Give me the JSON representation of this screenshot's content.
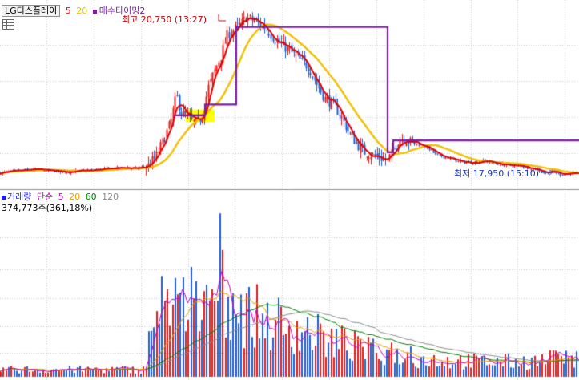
{
  "price_panel": {
    "stock_chip": "LG디스플레이",
    "ma_labels": [
      {
        "text": "5",
        "color": "#ff0000"
      },
      {
        "text": "20",
        "color": "#f2c000"
      }
    ],
    "indicator_label": "매수타이밍2",
    "indicator_color": "#7a1fa2",
    "high_label": "최고 20,750 (13:27)",
    "low_label": "최저 17,950 (15:10)",
    "annotation_color_high": "#cc0000",
    "annotation_color_low": "#1a3ac0"
  },
  "volume_panel": {
    "title": "거래량",
    "title_color": "#1a1aff",
    "ma_type": "단순",
    "ma_labels": [
      {
        "text": "5",
        "color": "#cc00cc"
      },
      {
        "text": "20",
        "color": "#e6a000"
      },
      {
        "text": "60",
        "color": "#008000"
      },
      {
        "text": "120",
        "color": "#8c8c8c"
      }
    ],
    "value_label": "374,773주(361,18%)"
  },
  "colors": {
    "up_candle": "#e11d1d",
    "down_candle": "#1f5fd6",
    "ma5": "#e00000",
    "ma20": "#f2c000",
    "signal_line": "#7a1fa2",
    "buy_zone": "#ffff00",
    "grid": "#c8c8c8"
  },
  "chart_data": {
    "type": "candlestick",
    "y_range": [
      17800,
      20800
    ],
    "high": {
      "value": 20750,
      "time": "13:27"
    },
    "low": {
      "value": 17950,
      "time": "15:10"
    },
    "price_path": [
      [
        0,
        17990
      ],
      [
        20,
        18020
      ],
      [
        40,
        18050
      ],
      [
        60,
        18030
      ],
      [
        80,
        18010
      ],
      [
        100,
        18020
      ],
      [
        120,
        18040
      ],
      [
        140,
        18070
      ],
      [
        160,
        18080
      ],
      [
        170,
        18060
      ],
      [
        185,
        18120
      ],
      [
        195,
        18300
      ],
      [
        205,
        18600
      ],
      [
        213,
        18900
      ],
      [
        220,
        19350
      ],
      [
        226,
        19050
      ],
      [
        232,
        19000
      ],
      [
        238,
        18900
      ],
      [
        246,
        18850
      ],
      [
        253,
        19050
      ],
      [
        260,
        19500
      ],
      [
        268,
        19800
      ],
      [
        276,
        20050
      ],
      [
        283,
        20400
      ],
      [
        292,
        20500
      ],
      [
        300,
        20600
      ],
      [
        307,
        20720
      ],
      [
        318,
        20650
      ],
      [
        330,
        20550
      ],
      [
        345,
        20300
      ],
      [
        360,
        20150
      ],
      [
        372,
        20000
      ],
      [
        385,
        19850
      ],
      [
        395,
        19550
      ],
      [
        405,
        19300
      ],
      [
        415,
        19200
      ],
      [
        425,
        19000
      ],
      [
        435,
        18700
      ],
      [
        445,
        18500
      ],
      [
        455,
        18350
      ],
      [
        465,
        18300
      ],
      [
        475,
        18250
      ],
      [
        483,
        18200
      ],
      [
        490,
        18350
      ],
      [
        498,
        18600
      ],
      [
        505,
        18580
      ],
      [
        515,
        18520
      ],
      [
        525,
        18480
      ],
      [
        535,
        18420
      ],
      [
        545,
        18300
      ],
      [
        560,
        18250
      ],
      [
        575,
        18180
      ],
      [
        590,
        18170
      ],
      [
        605,
        18200
      ],
      [
        620,
        18150
      ],
      [
        635,
        18120
      ],
      [
        650,
        18110
      ],
      [
        660,
        18080
      ],
      [
        670,
        18050
      ],
      [
        680,
        17990
      ],
      [
        690,
        18020
      ],
      [
        700,
        17960
      ],
      [
        710,
        17990
      ],
      [
        723,
        17960
      ]
    ],
    "volume_profile": [
      [
        0,
        12
      ],
      [
        180,
        12
      ],
      [
        185,
        40
      ],
      [
        190,
        90
      ],
      [
        200,
        110
      ],
      [
        215,
        150
      ],
      [
        225,
        110
      ],
      [
        240,
        130
      ],
      [
        255,
        120
      ],
      [
        265,
        190
      ],
      [
        272,
        230
      ],
      [
        280,
        140
      ],
      [
        290,
        120
      ],
      [
        310,
        100
      ],
      [
        330,
        95
      ],
      [
        350,
        90
      ],
      [
        370,
        80
      ],
      [
        390,
        70
      ],
      [
        410,
        60
      ],
      [
        430,
        55
      ],
      [
        450,
        45
      ],
      [
        470,
        40
      ],
      [
        490,
        35
      ],
      [
        510,
        32
      ],
      [
        540,
        28
      ],
      [
        570,
        26
      ],
      [
        600,
        25
      ],
      [
        630,
        25
      ],
      [
        660,
        25
      ],
      [
        690,
        28
      ],
      [
        723,
        28
      ]
    ],
    "volume_spikes": [
      [
        184,
        60
      ],
      [
        192,
        65
      ],
      [
        198,
        70
      ],
      [
        205,
        100
      ],
      [
        209,
        115
      ],
      [
        213,
        95
      ],
      [
        218,
        130
      ],
      [
        231,
        60
      ],
      [
        235,
        75
      ],
      [
        249,
        60
      ],
      [
        252,
        75
      ],
      [
        261,
        100
      ],
      [
        265,
        115
      ],
      [
        269,
        100
      ],
      [
        274,
        215
      ],
      [
        290,
        110
      ],
      [
        344,
        75
      ],
      [
        352,
        55
      ],
      [
        378,
        60
      ],
      [
        386,
        55
      ],
      [
        398,
        70
      ],
      [
        404,
        60
      ],
      [
        408,
        45
      ],
      [
        448,
        50
      ],
      [
        488,
        45
      ],
      [
        512,
        40
      ],
      [
        663,
        25
      ],
      [
        675,
        30
      ],
      [
        688,
        35
      ],
      [
        696,
        30
      ],
      [
        714,
        28
      ]
    ]
  }
}
